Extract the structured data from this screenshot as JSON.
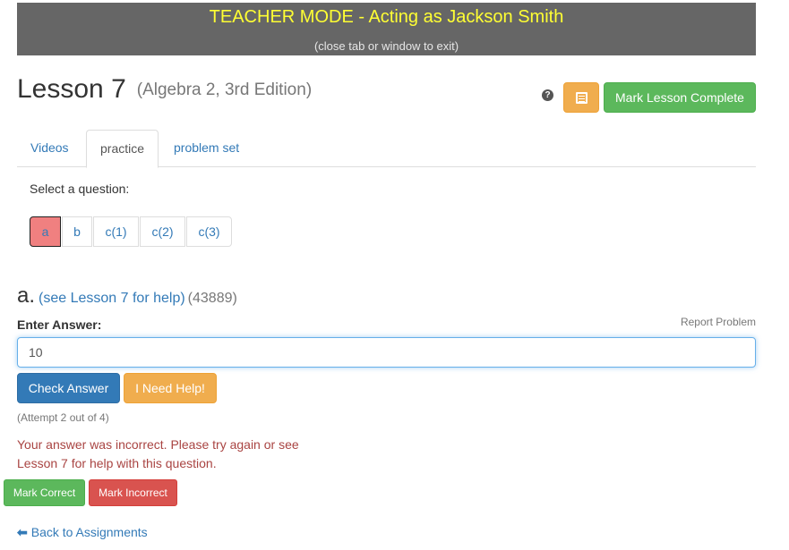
{
  "banner": {
    "title": "TEACHER MODE - Acting as Jackson Smith",
    "subtitle": "(close tab or window to exit)"
  },
  "header": {
    "title": "Lesson 7",
    "subtitle": "(Algebra 2, 3rd Edition)",
    "help_icon": "question-circle-icon",
    "help_glyph": "?",
    "notes_icon": "list-document-icon",
    "complete_label": "Mark Lesson Complete"
  },
  "tabs": [
    {
      "label": "Videos",
      "active": false
    },
    {
      "label": "practice",
      "active": true
    },
    {
      "label": "problem set",
      "active": false
    }
  ],
  "question_selector": {
    "label": "Select a question:",
    "options": [
      "a",
      "b",
      "c(1)",
      "c(2)",
      "c(3)"
    ],
    "selected": "a"
  },
  "question": {
    "letter": "a.",
    "help_link": "(see Lesson 7 for help)",
    "id": "(43889)",
    "answer_label": "Enter Answer:",
    "report_label": "Report Problem",
    "answer_value": "10",
    "check_label": "Check Answer",
    "need_help_label": "I Need Help!",
    "attempt_text": "(Attempt 2 out of 4)",
    "feedback": "Your answer was incorrect. Please try again or see Lesson 7 for help with this question."
  },
  "grading": {
    "mark_correct_label": "Mark Correct",
    "mark_incorrect_label": "Mark Incorrect"
  },
  "footer": {
    "back_icon": "arrow-left-icon",
    "back_glyph": "🡐",
    "back_label": "Back to Assignments"
  },
  "colors": {
    "banner_bg": "#666666",
    "banner_title": "#ffff33",
    "primary": "#337ab7",
    "success": "#5cb85c",
    "warning": "#f0ad4e",
    "danger": "#d9534f",
    "selected_question": "#f08080",
    "error_text": "#a94442"
  }
}
